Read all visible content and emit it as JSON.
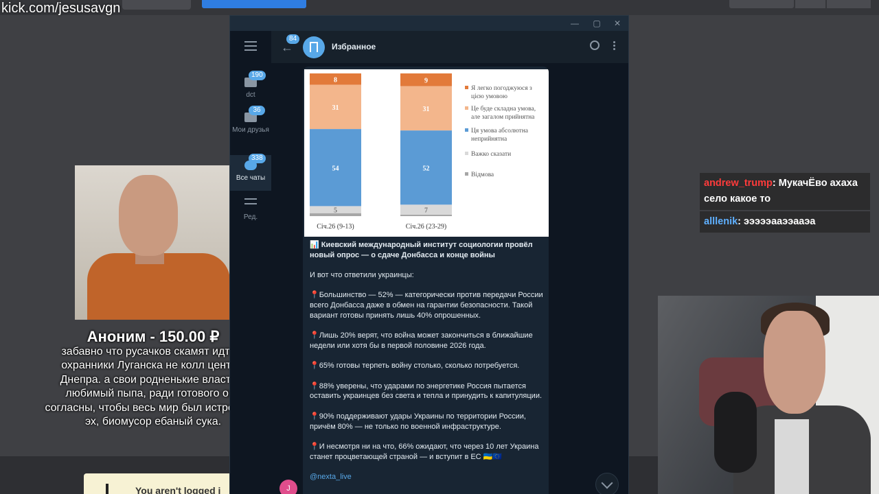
{
  "overlay": {
    "url": "kick.com/jesusavgn"
  },
  "background": {
    "login_text": "You aren't logged i"
  },
  "donation": {
    "title": "Аноним - 150.00 ₽",
    "message": "забавно что русачков скамят идти в охранники Луганска не колл центры Днепра. а свои родненькие власти и любимый пыпа, ради готового они согласны, чтобы весь мир был истреблен. эх, биомусор ебаный сука."
  },
  "chat": {
    "messages": [
      {
        "user": "andrew_trump",
        "text": ": МукачЁво ахаха село какое то"
      },
      {
        "user": "alllenik",
        "text": ": эээээааээааэа"
      }
    ]
  },
  "telegram": {
    "sidebar": {
      "folders": [
        {
          "label": "dct",
          "badge": "190"
        },
        {
          "label": "Мои друзья",
          "badge": "36"
        },
        {
          "label": "Все чаты",
          "badge": "338"
        },
        {
          "label": "Ред.",
          "badge": ""
        }
      ]
    },
    "header": {
      "back_badge": "84",
      "title": "Избранное"
    },
    "message": {
      "headline": "📊 Киевский международный институт социологии провёл новый опрос — о сдаче Донбасса и конце войны",
      "intro": "И вот что ответили украинцы:",
      "points": [
        "📍Большинство — 52% — категорически против передачи России всего Донбасса даже в обмен на гарантии безопасности. Такой вариант готовы принять лишь 40% опрошенных.",
        "📍Лишь 20% верят, что война может закончиться в ближайшие недели или хотя бы в первой половине 2026 года.",
        "📍65% готовы терпеть войну столько, сколько потребуется.",
        "📍88% уверены, что ударами по энергетике Россия пытается оставить украинцев без света и тепла и принудить к капитуляции.",
        "📍90% поддерживают удары Украины по территории России, причём 80% — не только по военной инфраструктуре.",
        "📍И несмотря ни на что, 66% ожидают, что через 10 лет Украина станет процветающей страной — и вступит в ЕС 🇺🇦🇪🇺"
      ],
      "link": "@nexta_live",
      "user_initial": "J"
    }
  },
  "chart_data": {
    "type": "bar",
    "stacked": true,
    "categories": [
      "Січ.26 (9-13)",
      "Січ.26 (23-29)"
    ],
    "series": [
      {
        "name": "Я легко погоджуюся з цією умовою",
        "values": [
          8,
          9
        ],
        "color": "#e27a3a"
      },
      {
        "name": "Це буде складна умова, але загалом прийнятна",
        "values": [
          31,
          31
        ],
        "color": "#f3b68c"
      },
      {
        "name": "Ця умова абсолютна неприйнятна",
        "values": [
          54,
          52
        ],
        "color": "#5b9bd5"
      },
      {
        "name": "Важко сказати",
        "values": [
          5,
          7
        ],
        "color": "#d9d9d9"
      },
      {
        "name": "Відмова",
        "values": [
          2,
          1
        ],
        "color": "#a6a6a6"
      }
    ],
    "legend": "right"
  }
}
